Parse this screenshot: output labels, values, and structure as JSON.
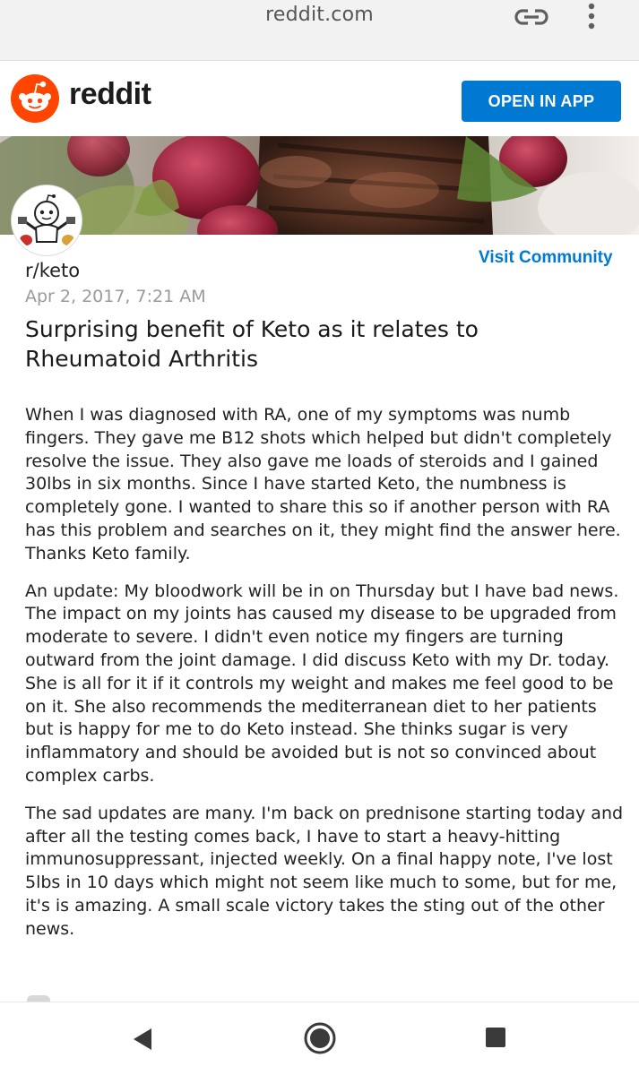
{
  "browser": {
    "url": "reddit.com",
    "icons": [
      "link-icon",
      "overflow-menu-icon"
    ]
  },
  "header": {
    "brand": "reddit",
    "open_app_label": "OPEN IN APP",
    "accent_color": "#0079d3",
    "logo_color": "#ff4500"
  },
  "community": {
    "name": "r/keto",
    "visit_label": "Visit Community"
  },
  "post": {
    "date": "Apr 2, 2017, 7:21 AM",
    "title": "Surprising benefit of Keto as it relates to Rheumatoid Arthritis",
    "paragraphs": [
      "When I was diagnosed with RA, one of my symptoms was numb fingers. They gave me B12 shots which helped but didn't completely resolve the issue. They also gave me loads of steroids and I gained 30lbs in six months. Since I have started Keto, the numbness is completely gone. I wanted to share this so if another person with RA has this problem and searches on it, they might find the answer here. Thanks Keto family.",
      "An update: My bloodwork will be in on Thursday but I have bad news. The impact on my joints has caused my disease to be upgraded from moderate to severe. I didn't even notice my fingers are turning outward from the joint damage. I did discuss Keto with my Dr. today. She is all for it if it controls my weight and makes me feel good to be on it. She also recommends the mediterranean diet to her patients but is happy for me to do Keto instead. She thinks sugar is very inflammatory and should be avoided but is not so convinced about complex carbs.",
      "The sad updates are many. I'm back on prednisone starting today and after all the testing comes back, I have to start a heavy-hitting immunosuppressant, injected weekly. On a final happy note, I've lost 5lbs in 10 days which might not seem like much to some, but for me, it's is amazing. A small scale victory takes the sting out of the other news."
    ]
  },
  "nav": {
    "icons": [
      "back-icon",
      "home-icon",
      "recents-icon"
    ]
  }
}
